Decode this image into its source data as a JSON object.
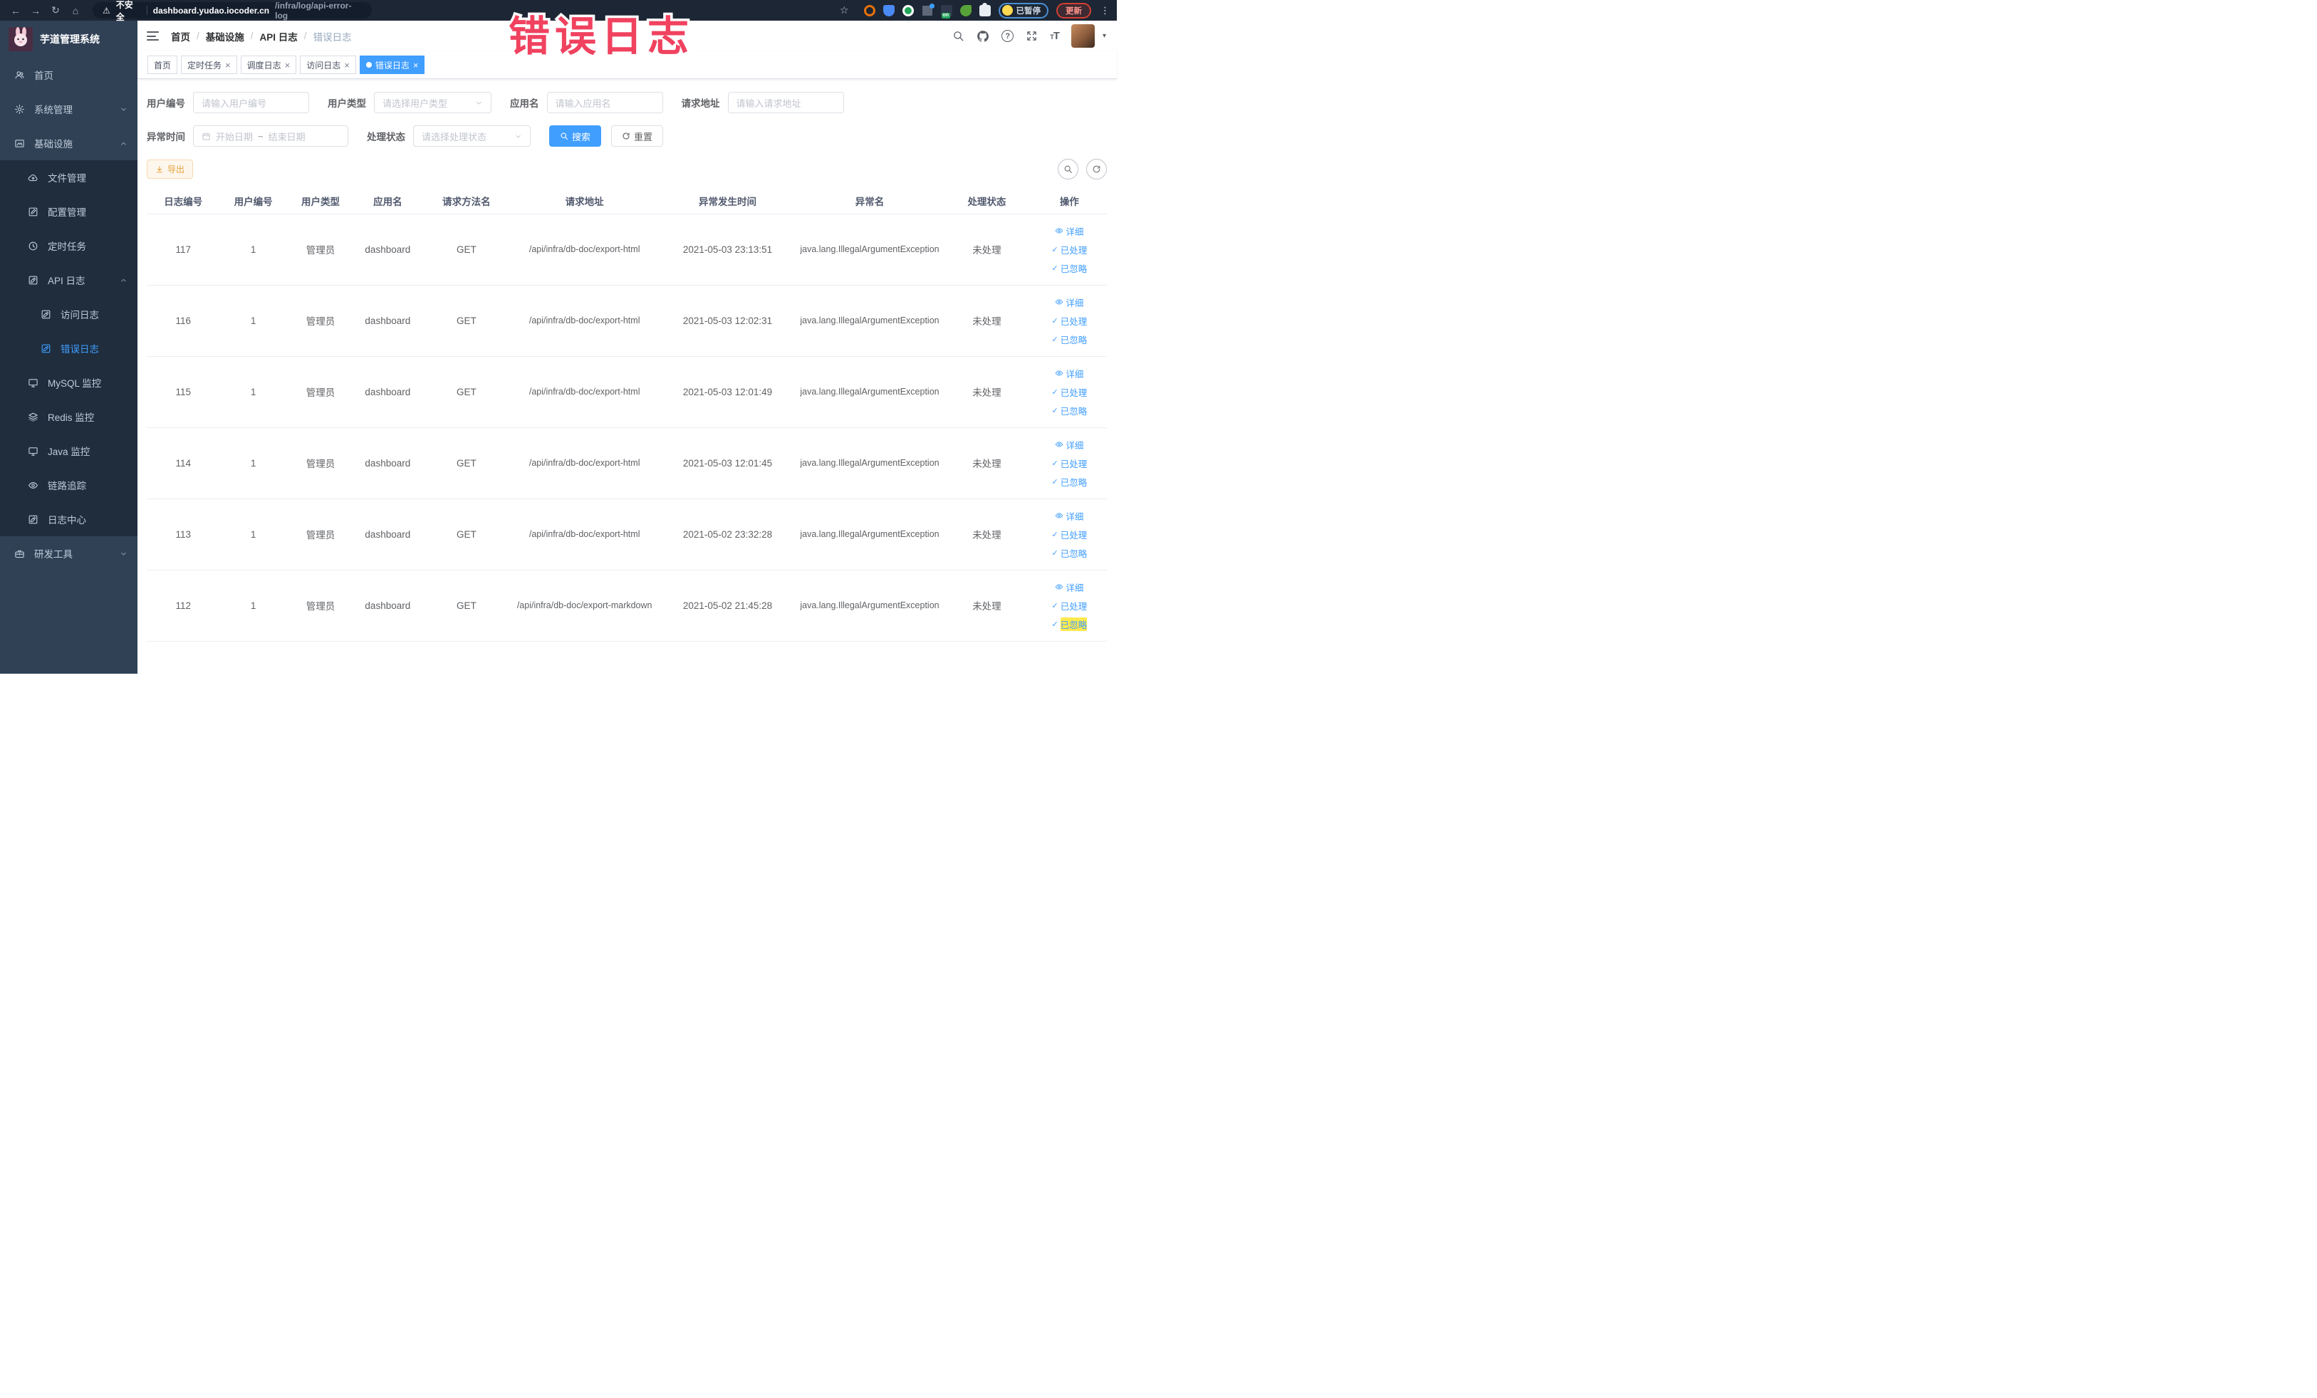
{
  "browser": {
    "security_label": "不安全",
    "url_host": "dashboard.yudao.iocoder.cn",
    "url_path": "/infra/log/api-error-log",
    "paused_badge": "已暂停",
    "update_button": "更新"
  },
  "annotation": {
    "text": "错误日志",
    "color": "#F0425F"
  },
  "colors": {
    "accent": "#409EFF",
    "warning": "#E6A23C",
    "sidebar_bg": "#304156",
    "submenu_bg": "#1F2D3D"
  },
  "sidebar": {
    "title": "芋道管理系统",
    "menu": [
      {
        "label": "首页"
      },
      {
        "label": "系统管理"
      },
      {
        "label": "基础设施"
      }
    ],
    "submenu": [
      {
        "label": "文件管理"
      },
      {
        "label": "配置管理"
      },
      {
        "label": "定时任务"
      },
      {
        "label": "API 日志"
      },
      {
        "label": "访问日志"
      },
      {
        "label": "错误日志"
      },
      {
        "label": "MySQL 监控"
      },
      {
        "label": "Redis 监控"
      },
      {
        "label": "Java 监控"
      },
      {
        "label": "链路追踪"
      },
      {
        "label": "日志中心"
      }
    ],
    "bottom_menu": [
      {
        "label": "研发工具"
      }
    ]
  },
  "header": {
    "breadcrumb": [
      "首页",
      "基础设施",
      "API 日志",
      "错误日志"
    ],
    "separator": "/"
  },
  "tabs": [
    {
      "label": "首页"
    },
    {
      "label": "定时任务"
    },
    {
      "label": "调度日志"
    },
    {
      "label": "访问日志"
    },
    {
      "label": "错误日志"
    }
  ],
  "filters": {
    "user_id": {
      "label": "用户编号",
      "placeholder": "请输入用户编号"
    },
    "user_type": {
      "label": "用户类型",
      "placeholder": "请选择用户类型"
    },
    "app_name": {
      "label": "应用名",
      "placeholder": "请输入应用名"
    },
    "request_url": {
      "label": "请求地址",
      "placeholder": "请输入请求地址"
    },
    "exception_time": {
      "label": "异常时间",
      "start_placeholder": "开始日期",
      "separator": "~",
      "end_placeholder": "结束日期"
    },
    "process_status": {
      "label": "处理状态",
      "placeholder": "请选择处理状态"
    },
    "search_button": "搜索",
    "reset_button": "重置"
  },
  "toolbar": {
    "export_button": "导出"
  },
  "table": {
    "columns": [
      "日志编号",
      "用户编号",
      "用户类型",
      "应用名",
      "请求方法名",
      "请求地址",
      "异常发生时间",
      "异常名",
      "处理状态",
      "操作"
    ],
    "actions": {
      "detail": "详细",
      "processed": "已处理",
      "ignored": "已忽略"
    },
    "rows": [
      {
        "id": "117",
        "user_id": "1",
        "user_type": "管理员",
        "app": "dashboard",
        "method": "GET",
        "url": "/api/infra/db-doc/export-html",
        "time": "2021-05-03 23:13:51",
        "exception": "java.lang.IllegalArgumentException",
        "status": "未处理"
      },
      {
        "id": "116",
        "user_id": "1",
        "user_type": "管理员",
        "app": "dashboard",
        "method": "GET",
        "url": "/api/infra/db-doc/export-html",
        "time": "2021-05-03 12:02:31",
        "exception": "java.lang.IllegalArgumentException",
        "status": "未处理"
      },
      {
        "id": "115",
        "user_id": "1",
        "user_type": "管理员",
        "app": "dashboard",
        "method": "GET",
        "url": "/api/infra/db-doc/export-html",
        "time": "2021-05-03 12:01:49",
        "exception": "java.lang.IllegalArgumentException",
        "status": "未处理"
      },
      {
        "id": "114",
        "user_id": "1",
        "user_type": "管理员",
        "app": "dashboard",
        "method": "GET",
        "url": "/api/infra/db-doc/export-html",
        "time": "2021-05-03 12:01:45",
        "exception": "java.lang.IllegalArgumentException",
        "status": "未处理"
      },
      {
        "id": "113",
        "user_id": "1",
        "user_type": "管理员",
        "app": "dashboard",
        "method": "GET",
        "url": "/api/infra/db-doc/export-html",
        "time": "2021-05-02 23:32:28",
        "exception": "java.lang.IllegalArgumentException",
        "status": "未处理"
      },
      {
        "id": "112",
        "user_id": "1",
        "user_type": "管理员",
        "app": "dashboard",
        "method": "GET",
        "url": "/api/infra/db-doc/export-markdown",
        "time": "2021-05-02 21:45:28",
        "exception": "java.lang.IllegalArgumentException",
        "status": "未处理"
      }
    ]
  }
}
